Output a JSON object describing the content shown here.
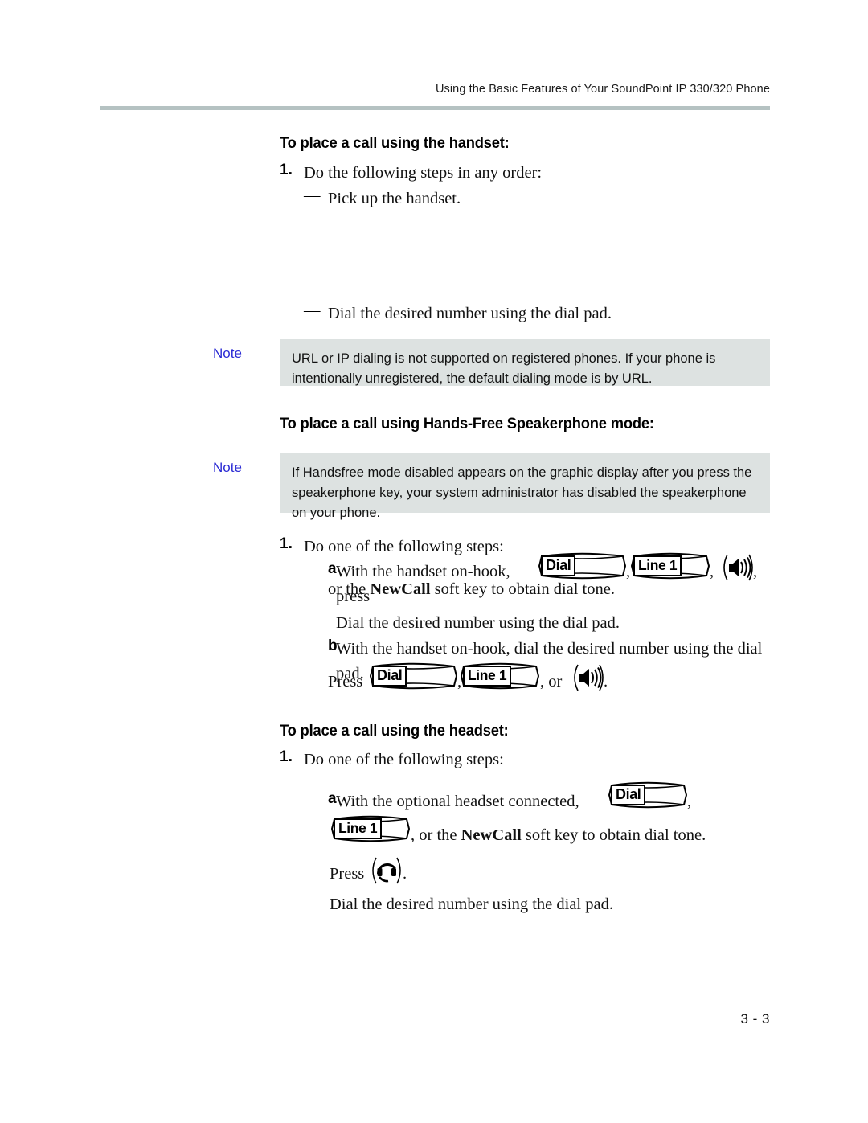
{
  "header": {
    "running_title": "Using the Basic Features of Your SoundPoint IP 330/320 Phone"
  },
  "footer": {
    "page_number": "3 - 3"
  },
  "colors": {
    "header_rule": "#b5c2c2",
    "note_background": "#dde2e1",
    "note_label": "#2b2bd4",
    "text": "#111111"
  },
  "sections": {
    "handset": {
      "heading": "To place a call using the handset:",
      "step1_number": "1.",
      "step1_text": "Do the following steps in any order:",
      "bullet_dash": "—",
      "bullet1_text": "Pick up the handset.",
      "bullet2_text": "Dial the desired number using the dial pad.",
      "note": {
        "label": "Note",
        "text": "URL or IP dialing is not supported on registered phones. If your phone is intentionally unregistered, the default dialing mode is by URL."
      }
    },
    "speakerphone": {
      "heading": "To place a call using Hands-Free Speakerphone mode:",
      "note": {
        "label": "Note",
        "text": "If  Handsfree mode disabled  appears on the graphic display after you press the speakerphone key, your system administrator has disabled the speakerphone on your phone."
      },
      "step1_number": "1.",
      "step1_text": "Do one of the following steps:",
      "step_a_letter": "a",
      "step_a_text_before": "With the handset on-hook, press",
      "step_a_comma1": ",",
      "step_a_comma2": ",",
      "step_a_comma3": ",",
      "step_a_line2_pre": "or the ",
      "step_a_line2_bold": "NewCall",
      "step_a_line2_post": " soft key to obtain dial tone.",
      "step_a_line3": "Dial the desired number using the dial pad.",
      "step_b_letter": "b",
      "step_b_text": "With the handset on-hook, dial the desired number using the dial pad.",
      "step_b_press": "Press",
      "step_b_comma1": ",",
      "step_b_or": ", or",
      "step_b_period": ".",
      "softkey_dial": "Dial",
      "softkey_line1": "Line 1"
    },
    "headset": {
      "heading": "To place a call using the headset:",
      "step1_number": "1.",
      "step1_text": "Do one of the following steps:",
      "step_a_letter": "a",
      "step_a_text_before": "With the optional headset connected, press",
      "step_a_comma": ",",
      "step_a_line2_pre": ", or the ",
      "step_a_line2_bold": "NewCall",
      "step_a_line2_post": " soft key to obtain dial tone.",
      "press_label": "Press",
      "press_period": ".",
      "last_line": "Dial the desired number using the dial pad.",
      "softkey_dial": "Dial",
      "softkey_line1": "Line 1"
    }
  },
  "icons": {
    "speaker": "speakerphone-icon",
    "headset": "headset-icon"
  }
}
